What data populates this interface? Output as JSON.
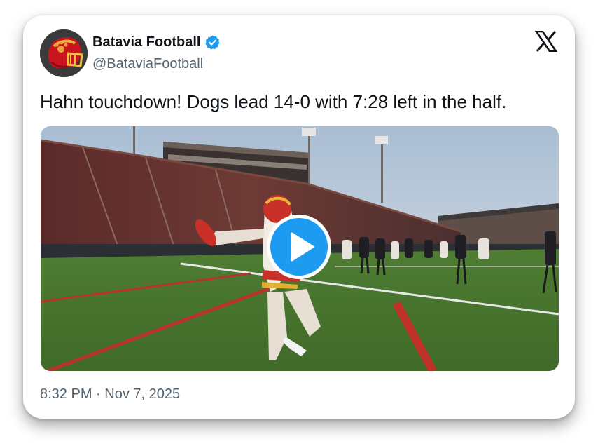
{
  "post": {
    "author": {
      "display_name": "Batavia Football",
      "handle": "@BataviaFootball",
      "verified": true,
      "avatar_icon": "helmet-icon"
    },
    "platform_icon": "x-logo-icon",
    "text": "Hahn touchdown! Dogs lead 14-0 with 7:28 left in the half.",
    "media": {
      "type": "video",
      "play_icon": "play-icon"
    },
    "timestamp": "8:32 PM · Nov 7, 2025"
  },
  "colors": {
    "verified_blue": "#1d9bf0",
    "text_primary": "#0f1419",
    "text_secondary": "#536471",
    "play_blue": "#1d9bf0"
  }
}
